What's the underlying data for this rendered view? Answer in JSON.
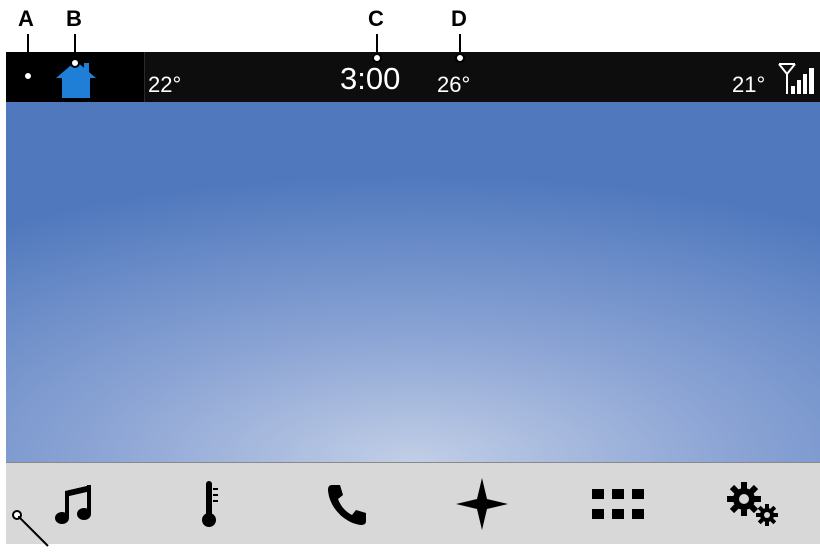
{
  "callouts": [
    "A",
    "B",
    "C",
    "D"
  ],
  "status_bar": {
    "left_temperature": "22°",
    "clock": "3:00",
    "outside_temperature": "26°",
    "right_temperature": "21°",
    "home_icon_color": "#1f7fd6"
  },
  "dock": {
    "items": [
      "music-icon",
      "climate-thermometer-icon",
      "phone-icon",
      "navigation-icon",
      "apps-grid-icon",
      "settings-gears-icon"
    ]
  }
}
